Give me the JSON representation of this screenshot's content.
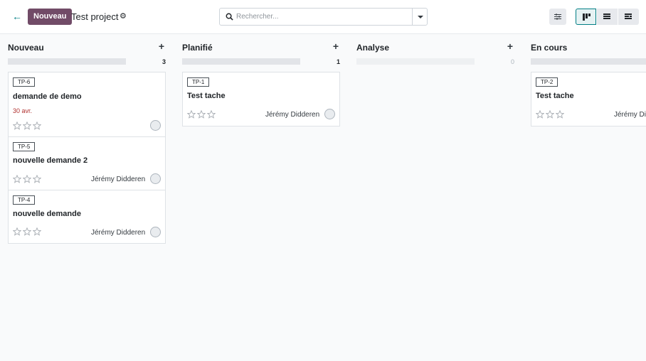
{
  "control_panel": {
    "new_label": "Nouveau",
    "project_name": "Test project",
    "search_placeholder": "Rechercher..."
  },
  "columns": [
    {
      "title": "Nouveau",
      "count": "3",
      "cards": [
        {
          "ref": "TP-6",
          "title": "demande de demo",
          "date": "30 avr.",
          "assignee": ""
        },
        {
          "ref": "TP-5",
          "title": "nouvelle demande 2",
          "date": "",
          "assignee": "Jérémy Didderen"
        },
        {
          "ref": "TP-4",
          "title": "nouvelle demande",
          "date": "",
          "assignee": "Jérémy Didderen"
        }
      ]
    },
    {
      "title": "Planifié",
      "count": "1",
      "cards": [
        {
          "ref": "TP-1",
          "title": "Test tache",
          "date": "",
          "assignee": "Jérémy Didderen"
        }
      ]
    },
    {
      "title": "Analyse",
      "count": "0",
      "cards": []
    },
    {
      "title": "En cours",
      "count": "",
      "cards": [
        {
          "ref": "TP-2",
          "title": "Test tache",
          "date": "",
          "assignee": "Jérémy Di"
        }
      ]
    }
  ],
  "icons": {
    "back": "arrow-left-icon",
    "gear": "gear-icon",
    "search": "search-icon",
    "filter": "sliders-icon",
    "kanban": "kanban-view-icon",
    "list": "list-view-icon",
    "activity": "activity-view-icon",
    "star": "star-outline-icon",
    "avatar": "avatar-placeholder"
  },
  "colors": {
    "primary": "#714b67",
    "accent": "#017e84",
    "deadline": "#b0302e"
  }
}
